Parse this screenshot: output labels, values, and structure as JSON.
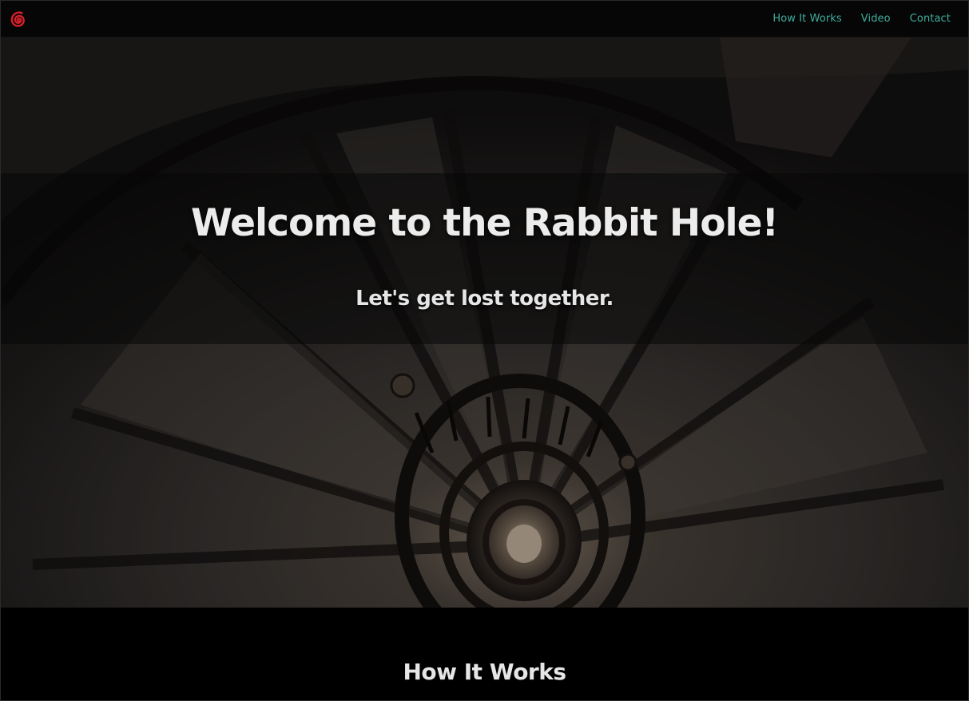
{
  "nav": {
    "logo_icon": "red-spiral-icon",
    "links": [
      {
        "label": "How It Works"
      },
      {
        "label": "Video"
      },
      {
        "label": "Contact"
      }
    ]
  },
  "hero": {
    "title": "Welcome to the Rabbit Hole!",
    "subtitle": "Let's get lost together.",
    "background_icon": "spiral-staircase-image"
  },
  "section": {
    "title": "How It Works"
  },
  "colors": {
    "nav_link": "#3fae9e",
    "logo": "#d8202a",
    "background": "#000000",
    "text": "#e8e8e8"
  }
}
